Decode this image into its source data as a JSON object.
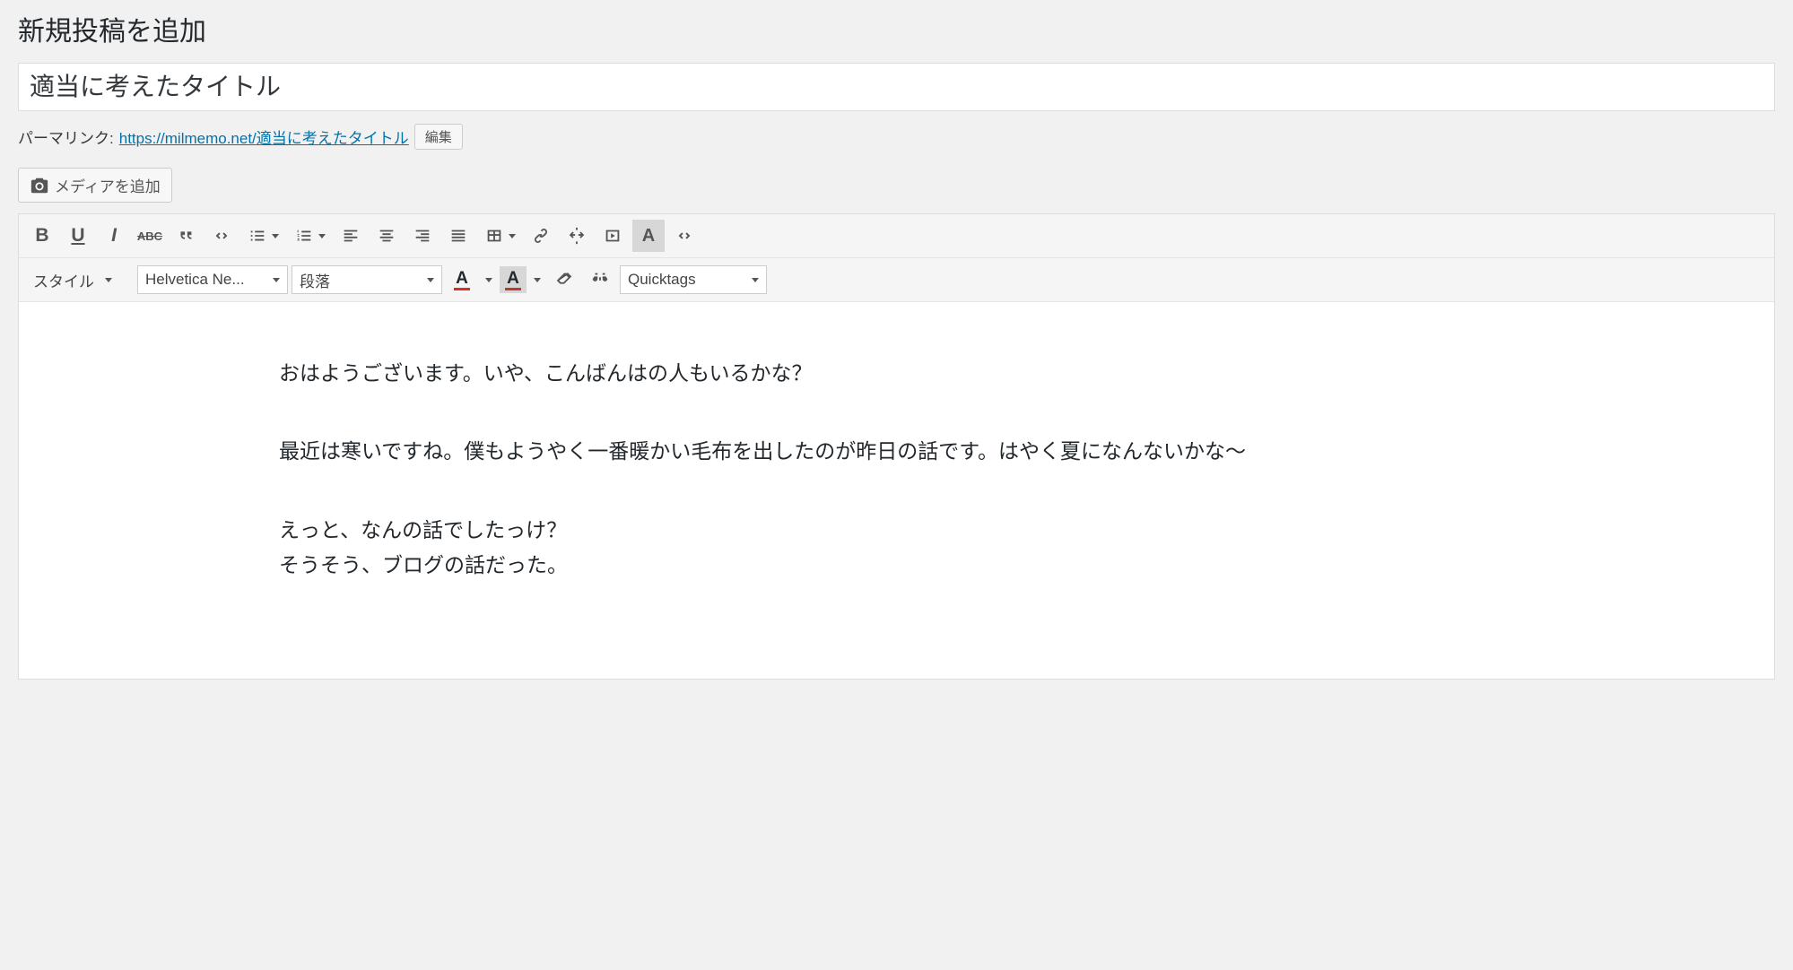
{
  "page": {
    "title": "新規投稿を追加"
  },
  "post": {
    "title": "適当に考えたタイトル"
  },
  "permalink": {
    "label": "パーマリンク:",
    "base": "https://milmemo.net/",
    "slug": "適当に考えたタイトル",
    "edit": "編集"
  },
  "media": {
    "add_label": "メディアを追加"
  },
  "toolbar": {
    "style": "スタイル",
    "font": "Helvetica Ne...",
    "paragraph": "段落",
    "quicktags": "Quicktags"
  },
  "content": {
    "p1": "おはようございます。いや、こんばんはの人もいるかな？",
    "p2": "最近は寒いですね。僕もようやく一番暖かい毛布を出したのが昨日の話です。はやく夏になんないかな〜",
    "p3a": "えっと、なんの話でしたっけ？",
    "p3b": "そうそう、ブログの話だった。"
  }
}
